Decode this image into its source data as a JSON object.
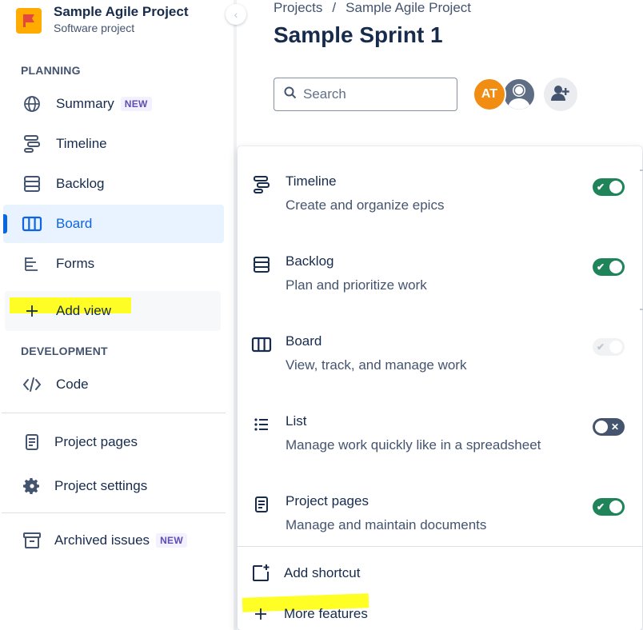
{
  "project": {
    "name": "Sample Agile Project",
    "type": "Software project"
  },
  "sidebar": {
    "planning_title": "PLANNING",
    "development_title": "DEVELOPMENT",
    "planning_items": [
      {
        "label": "Summary",
        "badge": "NEW",
        "icon": "globe-icon"
      },
      {
        "label": "Timeline",
        "icon": "timeline-icon"
      },
      {
        "label": "Backlog",
        "icon": "backlog-icon"
      },
      {
        "label": "Board",
        "icon": "board-icon",
        "active": true
      },
      {
        "label": "Forms",
        "icon": "forms-icon"
      }
    ],
    "add_view_label": "Add view",
    "development_items": [
      {
        "label": "Code",
        "icon": "code-icon"
      }
    ],
    "bottom_items": [
      {
        "label": "Project pages",
        "icon": "page-icon"
      },
      {
        "label": "Project settings",
        "icon": "gear-icon"
      }
    ],
    "archived": {
      "label": "Archived issues",
      "badge": "NEW",
      "icon": "archive-icon"
    }
  },
  "header": {
    "breadcrumb": [
      "Projects",
      "/",
      "Sample Agile Project"
    ],
    "title": "Sample Sprint 1",
    "search_placeholder": "Search",
    "avatar_initials": "AT"
  },
  "panel": {
    "features": [
      {
        "name": "Timeline",
        "desc": "Create and organize epics",
        "icon": "timeline-icon",
        "state": "on"
      },
      {
        "name": "Backlog",
        "desc": "Plan and prioritize work",
        "icon": "backlog-icon",
        "state": "on"
      },
      {
        "name": "Board",
        "desc": "View, track, and manage work",
        "icon": "board-icon",
        "state": "disabled"
      },
      {
        "name": "List",
        "desc": "Manage work quickly like in a spreadsheet",
        "icon": "list-icon",
        "state": "off"
      },
      {
        "name": "Project pages",
        "desc": "Manage and maintain documents",
        "icon": "page-icon",
        "state": "on"
      }
    ],
    "add_shortcut_label": "Add shortcut",
    "more_features_label": "More features"
  },
  "colors": {
    "accent": "#0c66e4",
    "toggle_on": "#1f845a",
    "toggle_off": "#44546f",
    "highlight": "#ffff00",
    "avatar": "#f18d13"
  }
}
